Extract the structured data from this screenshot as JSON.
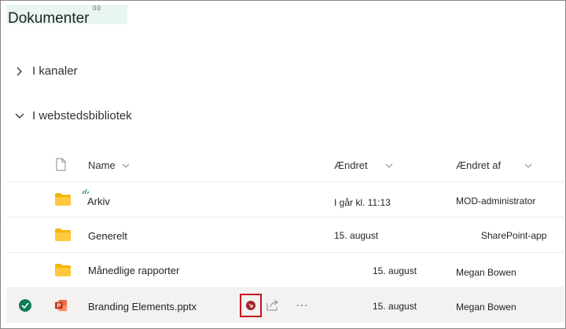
{
  "header": {
    "title": "Dokumenter",
    "badge": "00"
  },
  "sections": [
    {
      "label": "I kanaler",
      "expanded": false
    },
    {
      "label": "I webstedsbibliotek",
      "expanded": true
    }
  ],
  "table": {
    "columns": {
      "name": "Name",
      "modified": "Ændret",
      "modified_by": "Ændret af"
    },
    "rows": [
      {
        "type": "folder",
        "name": "Arkiv",
        "modified": "I går kl. 11:13",
        "modified_by": "MOD-administrator"
      },
      {
        "type": "folder",
        "name": "Generelt",
        "modified": "15. august",
        "modified_by": "SharePoint-app"
      },
      {
        "type": "folder",
        "name": "Månedlige rapporter",
        "modified": "15. august",
        "modified_by": "Megan Bowen"
      },
      {
        "type": "pptx",
        "name": "Branding Elements.pptx",
        "modified": "15. august",
        "modified_by": "Megan Bowen",
        "selected": true
      }
    ]
  },
  "colors": {
    "accent_green": "#0f7b55",
    "folder": "#f4b400",
    "highlight_red": "#c50f1f",
    "ppt_red": "#c43e1c"
  }
}
